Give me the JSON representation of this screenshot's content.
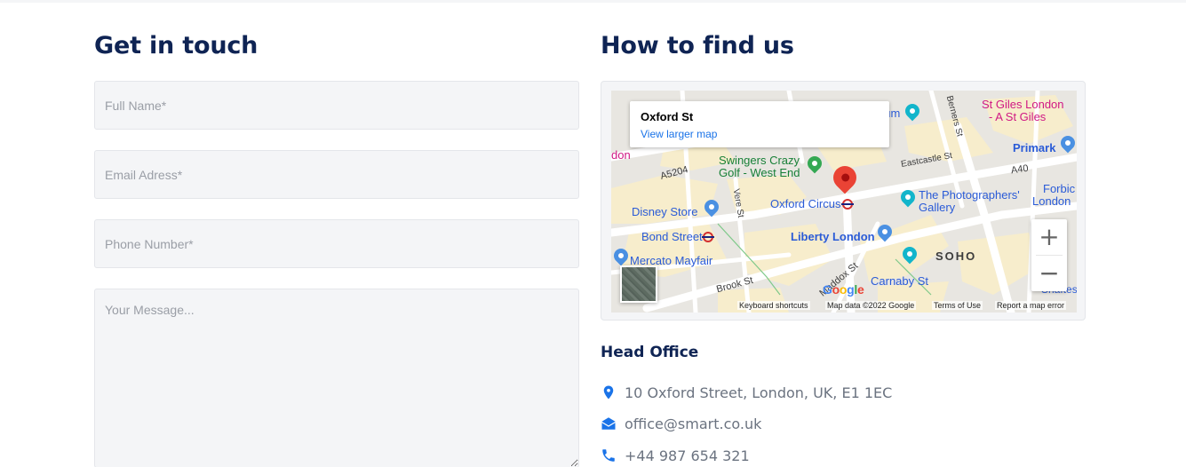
{
  "contact": {
    "title": "Get in touch",
    "fields": {
      "full_name_placeholder": "Full Name*",
      "email_placeholder": "Email Adress*",
      "phone_placeholder": "Phone Number*",
      "message_placeholder": "Your Message..."
    }
  },
  "find_us": {
    "title": "How to find us",
    "map": {
      "place_name": "Oxford St",
      "larger_map_link": "View larger map",
      "zoom_in": "+",
      "zoom_out": "−",
      "labels": {
        "swingers": "Swingers Crazy",
        "swingers2": "Golf - West End",
        "oxford_circus": "Oxford Circus",
        "disney": "Disney Store",
        "bond_street": "Bond Street",
        "liberty": "Liberty London",
        "mercato": "Mercato Mayfair",
        "soho": "SOHO",
        "carnaby": "Carnaby St",
        "photographers": "The Photographers'",
        "photographers2": "Gallery",
        "st_giles": "St Giles London",
        "st_giles2": "- A St Giles",
        "primark": "Primark",
        "forbidden": "Forbic",
        "forbidden2": "London",
        "museum": "eum",
        "brook_st": "Brook St",
        "maddox_st": "Maddox St",
        "vere_st": "Vere St",
        "a5204": "A5204",
        "a40": "A40",
        "eastcastle": "Eastcastle St",
        "berners": "Berners St",
        "don": "don",
        "shaftesbury": "Shaftesb"
      },
      "google_logo": "Google",
      "attribution": {
        "shortcuts": "Keyboard shortcuts",
        "map_data": "Map data ©2022 Google",
        "terms": "Terms of Use",
        "report": "Report a map error"
      },
      "colors": {
        "pin": "#ea4335",
        "poi_blue": "#4a90e2",
        "poi_teal": "#12b5cb",
        "poi_green": "#34a853",
        "poi_pink": "#d01884"
      }
    }
  },
  "office": {
    "title": "Head Office",
    "address": "10 Oxford Street, London, UK, E1 1EC",
    "email": "office@smart.co.uk",
    "phone": "+44 987 654 321",
    "icon_color": "#1a73e8"
  }
}
